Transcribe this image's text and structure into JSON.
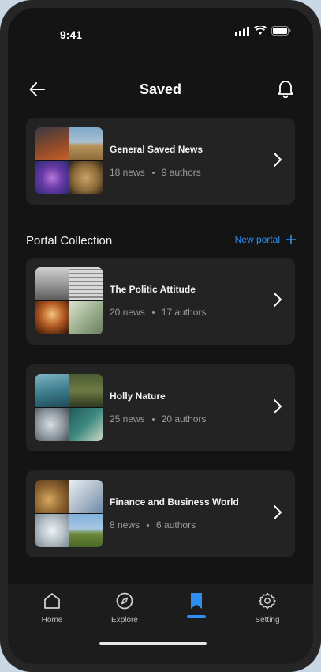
{
  "status_bar": {
    "time": "9:41"
  },
  "header": {
    "title": "Saved"
  },
  "featured_card": {
    "title": "General Saved News",
    "news": "18 news",
    "authors": "9 authors"
  },
  "section": {
    "title": "Portal Collection",
    "new_portal_label": "New portal"
  },
  "collections": [
    {
      "title": "The Politic Attitude",
      "news": "20 news",
      "authors": "17 authors"
    },
    {
      "title": "Holly Nature",
      "news": "25 news",
      "authors": "20 authors"
    },
    {
      "title": "Finance and Business World",
      "news": "8 news",
      "authors": "6 authors"
    }
  ],
  "bottom_nav": {
    "items": [
      {
        "label": "Home",
        "icon": "home-icon"
      },
      {
        "label": "Explore",
        "icon": "compass-icon"
      },
      {
        "label": "",
        "icon": "bookmark-icon",
        "active": true
      },
      {
        "label": "Setting",
        "icon": "gear-icon"
      }
    ]
  },
  "colors": {
    "accent": "#2f8ff0",
    "background": "#141414",
    "card": "#232323"
  }
}
